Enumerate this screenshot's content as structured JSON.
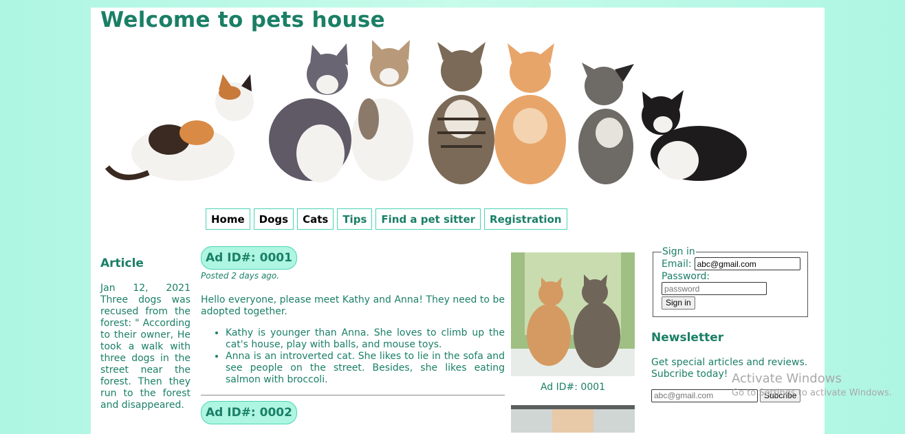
{
  "site": {
    "title": "Welcome to pets house"
  },
  "nav": {
    "items": [
      {
        "label": "Home"
      },
      {
        "label": "Dogs"
      },
      {
        "label": "Cats"
      },
      {
        "label": "Tips"
      },
      {
        "label": "Find a pet sitter"
      },
      {
        "label": "Registration"
      }
    ]
  },
  "article": {
    "heading": "Article",
    "body": "Jan 12, 2021 Three dogs was recused from the forest: \" According to their owner, He took a walk with three dogs in the street near the forest. Then they run to the forest and disappeared."
  },
  "ads": [
    {
      "badge": "Ad ID#: 0001",
      "posted": "Posted 2 days ago.",
      "intro": "Hello everyone, please meet Kathy and Anna! They need to be adopted together.",
      "bullets": [
        "Kathy is younger than Anna. She loves to climb up the cat's house, play with balls, and mouse toys.",
        "Anna is an introverted cat. She likes to lie in the sofa and see people on the street. Besides, she likes eating salmon with broccoli."
      ],
      "photo_caption": "Ad ID#: 0001"
    },
    {
      "badge": "Ad ID#: 0002"
    }
  ],
  "signin": {
    "legend": "Sign in",
    "email_label": "Email:",
    "email_value": "abc@gmail.com",
    "password_label": "Password:",
    "password_placeholder": "password",
    "button": "Sign in"
  },
  "newsletter": {
    "heading": "Newsletter",
    "text": "Get special articles and reviews. Subcribe today!",
    "email_placeholder": "abc@gmail.com",
    "button": "Subcribe"
  },
  "watermark": {
    "line1": "Activate Windows",
    "line2": "Go to Settings to activate Windows."
  },
  "colors": {
    "accent": "#1a7f66",
    "border_accent": "#49d4b4",
    "badge_bg": "#aef6e2",
    "page_bg": "#c7fbea"
  }
}
